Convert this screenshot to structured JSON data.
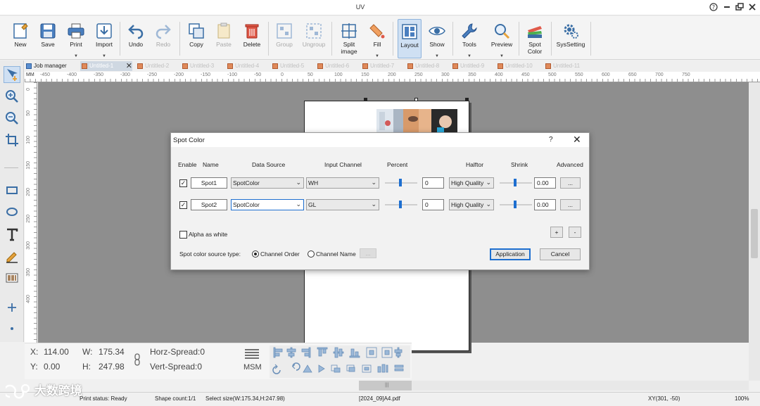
{
  "window": {
    "title": "UV"
  },
  "toolbar": {
    "new": "New",
    "save": "Save",
    "print": "Print",
    "import": "Import",
    "undo": "Undo",
    "redo": "Redo",
    "copy": "Copy",
    "paste": "Paste",
    "delete": "Delete",
    "group": "Group",
    "ungroup": "Ungroup",
    "split_image": "Split image",
    "fill": "Fill",
    "layout": "Layout",
    "show": "Show",
    "tools": "Tools",
    "preview": "Preview",
    "spot_color": "Spot Color",
    "syssetting": "SysSetting"
  },
  "tabs": [
    "Job manager",
    "Untitled-1",
    "Untitled-2",
    "Untitled-3",
    "Untitled-4",
    "Untitled-5",
    "Untitled-6",
    "Untitled-7",
    "Untitled-8",
    "Untitled-9",
    "Untitled-10",
    "Untitled-11"
  ],
  "ruler": {
    "unit": "MM",
    "h_ticks": [
      "-450",
      "-400",
      "-350",
      "-300",
      "-250",
      "-200",
      "-150",
      "-100",
      "-50",
      "0",
      "50",
      "100",
      "150",
      "200",
      "250",
      "300",
      "350",
      "400",
      "450",
      "500",
      "550",
      "600",
      "650",
      "700",
      "750"
    ],
    "v_ticks": [
      "0",
      "50",
      "100",
      "150",
      "200",
      "250",
      "300",
      "350",
      "400"
    ]
  },
  "dialog": {
    "title": "Spot Color",
    "help": "?",
    "close": "✕",
    "headers": {
      "enable": "Enable",
      "name": "Name",
      "data_source": "Data Source",
      "input_channel": "Input Channel",
      "percent": "Percent",
      "halftone": "Halftor",
      "shrink": "Shrink",
      "advanced": "Advanced"
    },
    "rows": [
      {
        "enabled": true,
        "name": "Spot1",
        "data_source": "SpotColor",
        "input_channel": "WH",
        "percent": "0",
        "halftone": "High Quality",
        "shrink": "0.00",
        "advanced": "..."
      },
      {
        "enabled": true,
        "name": "Spot2",
        "data_source": "SpotColor",
        "input_channel": "GL",
        "percent": "0",
        "halftone": "High Quality",
        "shrink": "0.00",
        "advanced": "..."
      }
    ],
    "alpha_as_white": "Alpha as white",
    "add": "+",
    "remove": "-",
    "source_type_label": "Spot color source type:",
    "channel_order": "Channel Order",
    "channel_name": "Channel Name",
    "ellipsis": "...",
    "application": "Application",
    "cancel": "Cancel"
  },
  "props": {
    "x_label": "X:",
    "x": "114.00",
    "y_label": "Y:",
    "y": "0.00",
    "w_label": "W:",
    "w": "175.34",
    "h_label": "H:",
    "h": "247.98",
    "horz_spread": "Horz-Spread:0",
    "vert_spread": "Vert-Spread:0",
    "msm": "MSM"
  },
  "status": {
    "print_status": "Print status: Ready",
    "shape_count": "Shape count:1/1",
    "select_size": "Select size(W:175.34,H:247.98)",
    "file": "[2024_09]A4.pdf",
    "xy": "XY(301, -50)",
    "zoom": "100%"
  },
  "watermark": "大数跨境",
  "colors": {
    "accent": "#1e6fd0",
    "canvas": "#8e8e8e",
    "selected_tool": "#cfe0f3"
  }
}
